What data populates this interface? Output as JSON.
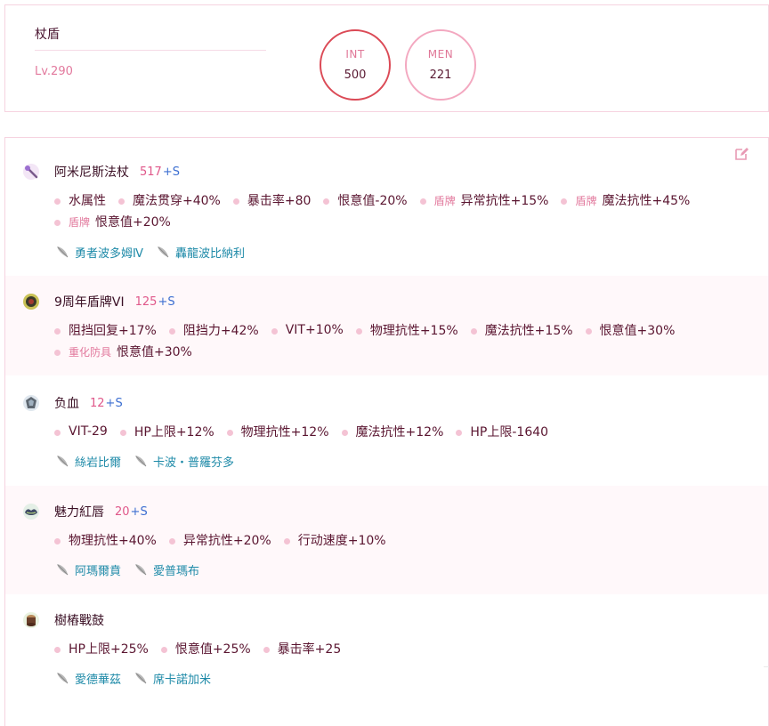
{
  "header": {
    "item_type": "杖盾",
    "level": "Lv.290",
    "stats": [
      {
        "label": "INT",
        "value": "500",
        "color": "#db4a56"
      },
      {
        "label": "MEN",
        "value": "221",
        "color": "#f3a8c0"
      }
    ]
  },
  "entries": [
    {
      "name": "阿米尼斯法杖",
      "level": "517",
      "suffix": "+S",
      "icon": "staff-icon",
      "line1": [
        {
          "tag": "",
          "text": "水属性"
        },
        {
          "tag": "",
          "text": "魔法贯穿+40%"
        },
        {
          "tag": "",
          "text": "暴击率+80"
        },
        {
          "tag": "",
          "text": "恨意值-20%"
        },
        {
          "tag": "盾牌",
          "text": "异常抗性+15%"
        },
        {
          "tag": "盾牌",
          "text": "魔法抗性+45%"
        }
      ],
      "line2": [
        {
          "tag": "盾牌",
          "text": "恨意值+20%"
        }
      ],
      "sources": [
        "勇者波多姆Ⅳ",
        "轟龍波比納利"
      ]
    },
    {
      "name": "9周年盾牌VI",
      "level": "125",
      "suffix": "+S",
      "icon": "shield-icon",
      "line1": [
        {
          "tag": "",
          "text": "阻挡回复+17%"
        },
        {
          "tag": "",
          "text": "阻挡力+42%"
        },
        {
          "tag": "",
          "text": "VIT+10%"
        },
        {
          "tag": "",
          "text": "物理抗性+15%"
        },
        {
          "tag": "",
          "text": "魔法抗性+15%"
        },
        {
          "tag": "",
          "text": "恨意值+30%"
        }
      ],
      "line2": [
        {
          "tag": "重化防具",
          "text": "恨意值+30%"
        }
      ],
      "sources": []
    },
    {
      "name": "负血",
      "level": "12",
      "suffix": "+S",
      "icon": "armor-icon",
      "line1": [
        {
          "tag": "",
          "text": "VIT-29"
        },
        {
          "tag": "",
          "text": "HP上限+12%"
        },
        {
          "tag": "",
          "text": "物理抗性+12%"
        },
        {
          "tag": "",
          "text": "魔法抗性+12%"
        },
        {
          "tag": "",
          "text": "HP上限-1640"
        }
      ],
      "line2": [],
      "sources": [
        "絲岩比爾",
        "卡波・普羅芬多"
      ]
    },
    {
      "name": "魅力紅唇",
      "level": "20",
      "suffix": "+S",
      "icon": "lips-icon",
      "line1": [
        {
          "tag": "",
          "text": "物理抗性+40%"
        },
        {
          "tag": "",
          "text": "异常抗性+20%"
        },
        {
          "tag": "",
          "text": "行动速度+10%"
        }
      ],
      "line2": [],
      "sources": [
        "阿瑪爾賁",
        "愛普瑪布"
      ]
    },
    {
      "name": "樹樁戰鼓",
      "level": "",
      "suffix": "",
      "icon": "drum-icon",
      "line1": [
        {
          "tag": "",
          "text": "HP上限+25%"
        },
        {
          "tag": "",
          "text": "恨意值+25%"
        },
        {
          "tag": "",
          "text": "暴击率+25"
        }
      ],
      "line2": [],
      "sources": [
        "愛德華茲",
        "席卡諾加米"
      ]
    }
  ]
}
